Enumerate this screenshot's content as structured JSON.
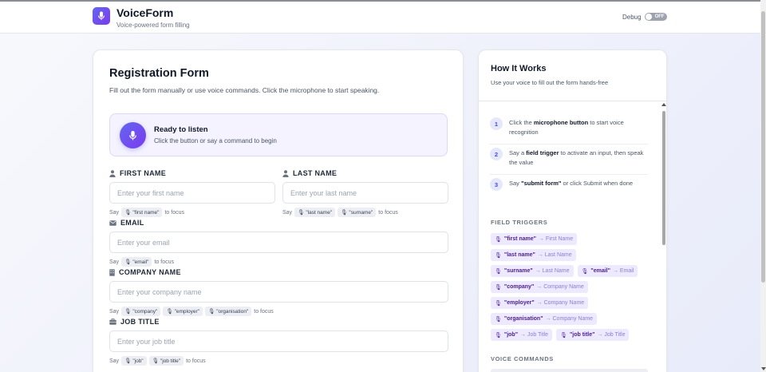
{
  "header": {
    "title": "VoiceForm",
    "subtitle": "Voice-powered form filling",
    "debug_label": "Debug",
    "debug_state": "OFF"
  },
  "form": {
    "title": "Registration Form",
    "description": "Fill out the form manually or use voice commands. Click the microphone to start speaking.",
    "listen_title": "Ready to listen",
    "listen_sub": "Click the button or say a command to begin",
    "say": "Say",
    "to_focus": "to focus",
    "fields": {
      "first_name": {
        "label": "FIRST NAME",
        "placeholder": "Enter your first name",
        "chips": [
          "\"first name\""
        ]
      },
      "last_name": {
        "label": "LAST NAME",
        "placeholder": "Enter your last name",
        "chips": [
          "\"last name\"",
          "\"surname\""
        ]
      },
      "email": {
        "label": "EMAIL",
        "placeholder": "Enter your email",
        "chips": [
          "\"email\""
        ]
      },
      "company": {
        "label": "COMPANY NAME",
        "placeholder": "Enter your company name",
        "chips": [
          "\"company\"",
          "\"employer\"",
          "\"organisation\""
        ]
      },
      "job": {
        "label": "JOB TITLE",
        "placeholder": "Enter your job title",
        "chips": [
          "\"job\"",
          "\"job title\""
        ]
      }
    }
  },
  "side": {
    "title": "How It Works",
    "subtitle": "Use your voice to fill out the form hands-free",
    "steps": [
      {
        "num": "1",
        "pre": "Click the ",
        "bold": "microphone button",
        "post": " to start voice recognition"
      },
      {
        "num": "2",
        "pre": "Say a ",
        "bold": "field trigger",
        "post": " to activate an input, then speak the value"
      },
      {
        "num": "3",
        "pre": "Say ",
        "bold": "\"submit form\"",
        "post": " or click Submit when done"
      }
    ],
    "triggers_label": "FIELD TRIGGERS",
    "triggers": [
      {
        "phrase": "\"first name\"",
        "target": "→ First Name"
      },
      {
        "phrase": "\"last name\"",
        "target": "→ Last Name"
      },
      {
        "phrase": "\"surname\"",
        "target": "→ Last Name"
      },
      {
        "phrase": "\"email\"",
        "target": "→ Email"
      },
      {
        "phrase": "\"company\"",
        "target": "→ Company Name"
      },
      {
        "phrase": "\"employer\"",
        "target": "→ Company Name"
      },
      {
        "phrase": "\"organisation\"",
        "target": "→ Company Name"
      },
      {
        "phrase": "\"job\"",
        "target": "→ Job Title"
      },
      {
        "phrase": "\"job title\"",
        "target": "→ Job Title"
      }
    ],
    "commands_label": "VOICE COMMANDS"
  },
  "colors": {
    "accent": "#6366f1",
    "accent_dark": "#7c3aed",
    "chip_bg": "#ede9fe"
  }
}
